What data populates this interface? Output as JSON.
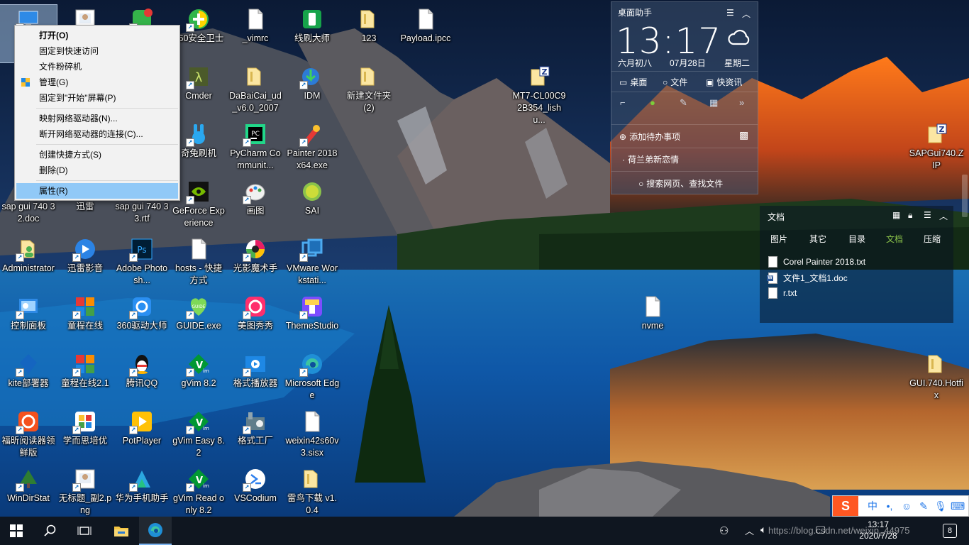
{
  "desktop": {
    "icons": [
      {
        "name": "this-pc",
        "label": "",
        "glyph": "pc"
      },
      {
        "name": "icon-pic1",
        "label": "",
        "glyph": "png"
      },
      {
        "name": "icon-app1",
        "label": "",
        "glyph": "app"
      },
      {
        "name": "icon-360safe",
        "label": "360安全卫士",
        "glyph": "360"
      },
      {
        "name": "icon-vimrc",
        "label": "_vimrc",
        "glyph": "file"
      },
      {
        "name": "icon-xianshua",
        "label": "线刷大师",
        "glyph": "green"
      },
      {
        "name": "icon-123",
        "label": "123",
        "glyph": "folder"
      },
      {
        "name": "icon-payload",
        "label": "Payload.ipcc",
        "glyph": "file"
      },
      {
        "name": "icon-cmder",
        "label": "Cmder",
        "glyph": "cmder"
      },
      {
        "name": "icon-dabaicai",
        "label": "DaBaiCai_ud_v6.0_2007",
        "glyph": "folder"
      },
      {
        "name": "icon-idm",
        "label": "IDM",
        "glyph": "idm"
      },
      {
        "name": "icon-newfolder2",
        "label": "新建文件夹 (2)",
        "glyph": "folder"
      },
      {
        "name": "icon-qitu",
        "label": "奇兔刷机",
        "glyph": "rabbit"
      },
      {
        "name": "icon-pycharm",
        "label": "PyCharm Communit...",
        "glyph": "pycharm"
      },
      {
        "name": "icon-painter",
        "label": "Painter 2018 x64.exe",
        "glyph": "painter"
      },
      {
        "name": "icon-sapdoc",
        "label": "sap gui 740 32.doc",
        "glyph": "none"
      },
      {
        "name": "icon-xunlei",
        "label": "迅雷",
        "glyph": "none"
      },
      {
        "name": "icon-saprtf",
        "label": "sap gui 740 33.rtf",
        "glyph": "none"
      },
      {
        "name": "icon-geforce",
        "label": "GeForce Experience",
        "glyph": "nvidia"
      },
      {
        "name": "icon-huatu",
        "label": "画图",
        "glyph": "paint"
      },
      {
        "name": "icon-sai",
        "label": "SAI",
        "glyph": "sai"
      },
      {
        "name": "icon-admin",
        "label": "Administrator",
        "glyph": "user"
      },
      {
        "name": "icon-xunleiying",
        "label": "迅雷影音",
        "glyph": "xly"
      },
      {
        "name": "icon-photoshop",
        "label": "Adobe Photosh...",
        "glyph": "ps"
      },
      {
        "name": "icon-hosts",
        "label": "hosts - 快捷方式",
        "glyph": "file"
      },
      {
        "name": "icon-guangying",
        "label": "光影魔术手",
        "glyph": "gy"
      },
      {
        "name": "icon-vmware",
        "label": "VMware Workstati...",
        "glyph": "vm"
      },
      {
        "name": "icon-controlpanel",
        "label": "控制面板",
        "glyph": "cp"
      },
      {
        "name": "icon-tongcheng",
        "label": "童程在线",
        "glyph": "tc"
      },
      {
        "name": "icon-360driver",
        "label": "360驱动大师",
        "glyph": "360d"
      },
      {
        "name": "icon-guide",
        "label": "GUIDE.exe",
        "glyph": "guide"
      },
      {
        "name": "icon-meitu",
        "label": "美图秀秀",
        "glyph": "meitu"
      },
      {
        "name": "icon-themestudio",
        "label": "ThemeStudio",
        "glyph": "theme"
      },
      {
        "name": "icon-nvme",
        "label": "nvme",
        "glyph": "file"
      },
      {
        "name": "icon-kite",
        "label": "kite部署器",
        "glyph": "kite"
      },
      {
        "name": "icon-tongcheng21",
        "label": "童程在线2.1",
        "glyph": "tc"
      },
      {
        "name": "icon-qq",
        "label": "腾讯QQ",
        "glyph": "qq"
      },
      {
        "name": "icon-gvim",
        "label": "gVim 8.2",
        "glyph": "vim"
      },
      {
        "name": "icon-geshiplayer",
        "label": "格式播放器",
        "glyph": "gsp"
      },
      {
        "name": "icon-edge",
        "label": "Microsoft Edge",
        "glyph": "edge"
      },
      {
        "name": "icon-foxit",
        "label": "福昕阅读器领鲜版",
        "glyph": "foxit"
      },
      {
        "name": "icon-xueersi",
        "label": "学而思培优",
        "glyph": "xes"
      },
      {
        "name": "icon-potplayer",
        "label": "PotPlayer",
        "glyph": "pot"
      },
      {
        "name": "icon-gvimeasy",
        "label": "gVim Easy 8.2",
        "glyph": "vim"
      },
      {
        "name": "icon-geshigongchang",
        "label": "格式工厂",
        "glyph": "gsgc"
      },
      {
        "name": "icon-weixin-sisx",
        "label": "weixin42s60v3.sisx",
        "glyph": "file"
      },
      {
        "name": "icon-windirstat",
        "label": "WinDirStat",
        "glyph": "wds"
      },
      {
        "name": "icon-untitled",
        "label": "无标题_副2.png",
        "glyph": "png"
      },
      {
        "name": "icon-huawei",
        "label": "华为手机助手",
        "glyph": "huawei"
      },
      {
        "name": "icon-gvimread",
        "label": "gVim Read only 8.2",
        "glyph": "vim"
      },
      {
        "name": "icon-vscodium",
        "label": "VSCodium",
        "glyph": "codium"
      },
      {
        "name": "icon-leiniao",
        "label": "雷鸟下载 v1.0.4",
        "glyph": "folder"
      },
      {
        "name": "icon-mt7",
        "label": "MT7-CL00C92B354_lishu...",
        "glyph": "zip"
      },
      {
        "name": "icon-sapgui-zip",
        "label": "SAPGui740.ZIP",
        "glyph": "zip"
      },
      {
        "name": "icon-gui-hotfix",
        "label": "GUI.740.Hotfix",
        "glyph": "folder"
      }
    ]
  },
  "context_menu": {
    "items": [
      {
        "label": "打开(O)",
        "bold": true
      },
      {
        "label": "固定到快速访问"
      },
      {
        "label": "文件粉碎机"
      },
      {
        "label": "管理(G)",
        "shield": true
      },
      {
        "label": "固定到\"开始\"屏幕(P)"
      },
      {
        "sep": true
      },
      {
        "label": "映射网络驱动器(N)..."
      },
      {
        "label": "断开网络驱动器的连接(C)..."
      },
      {
        "sep": true
      },
      {
        "label": "创建快捷方式(S)"
      },
      {
        "label": "删除(D)"
      },
      {
        "sep": true
      },
      {
        "label": "属性(R)",
        "highlight": true
      }
    ]
  },
  "assistant": {
    "title": "桌面助手",
    "time": "13:17",
    "lunar": "六月初八",
    "date": "07月28日",
    "weekday": "星期二",
    "tab_desktop": "桌面",
    "tab_file": "文件",
    "tab_news": "快资讯",
    "add_todo": "添加待办事项",
    "news_item": "荷兰弟新恋情",
    "search_label": "搜索网页、查找文件"
  },
  "docs_panel": {
    "title": "文档",
    "tabs": [
      "图片",
      "其它",
      "目录",
      "文档",
      "压缩"
    ],
    "active_tab": "文档",
    "files": [
      {
        "name": "Corel Painter 2018.txt",
        "type": "txt"
      },
      {
        "name": "文件1_文档1.doc",
        "type": "doc"
      },
      {
        "name": "r.txt",
        "type": "txt"
      }
    ]
  },
  "ime": {
    "mode": "中"
  },
  "taskbar": {
    "clock_time": "13:17",
    "clock_date": "2020/7/28",
    "notification_count": "8",
    "watermark": "https://blog.csdn.net/weixin_44975"
  },
  "colors": {
    "accent": "#0078d7",
    "menu_highlight": "#91c9f7",
    "active_tab": "#8bc34a"
  }
}
